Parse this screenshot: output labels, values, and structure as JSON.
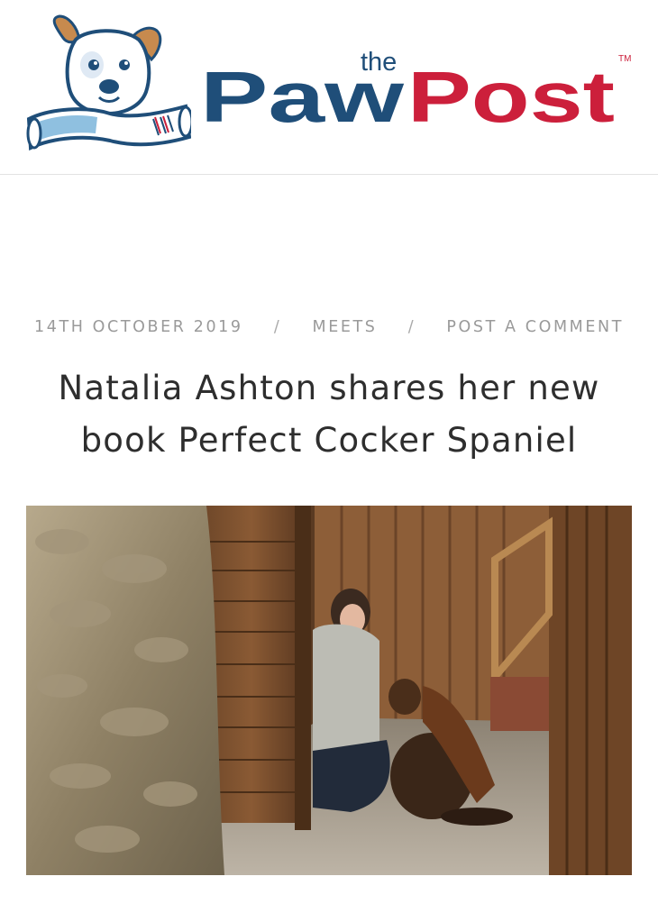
{
  "brand": {
    "prefix": "the",
    "name_part1": "Paw",
    "name_part2": "Post",
    "trademark": "TM",
    "colors": {
      "navy": "#1f4e79",
      "red": "#cc1f3b"
    }
  },
  "post": {
    "date": "14TH OCTOBER 2019",
    "separator": "/",
    "category": "MEETS",
    "comment_link": "POST A COMMENT",
    "title_line1": "Natalia Ashton shares her new",
    "title_line2": "book Perfect Cocker Spaniel"
  }
}
